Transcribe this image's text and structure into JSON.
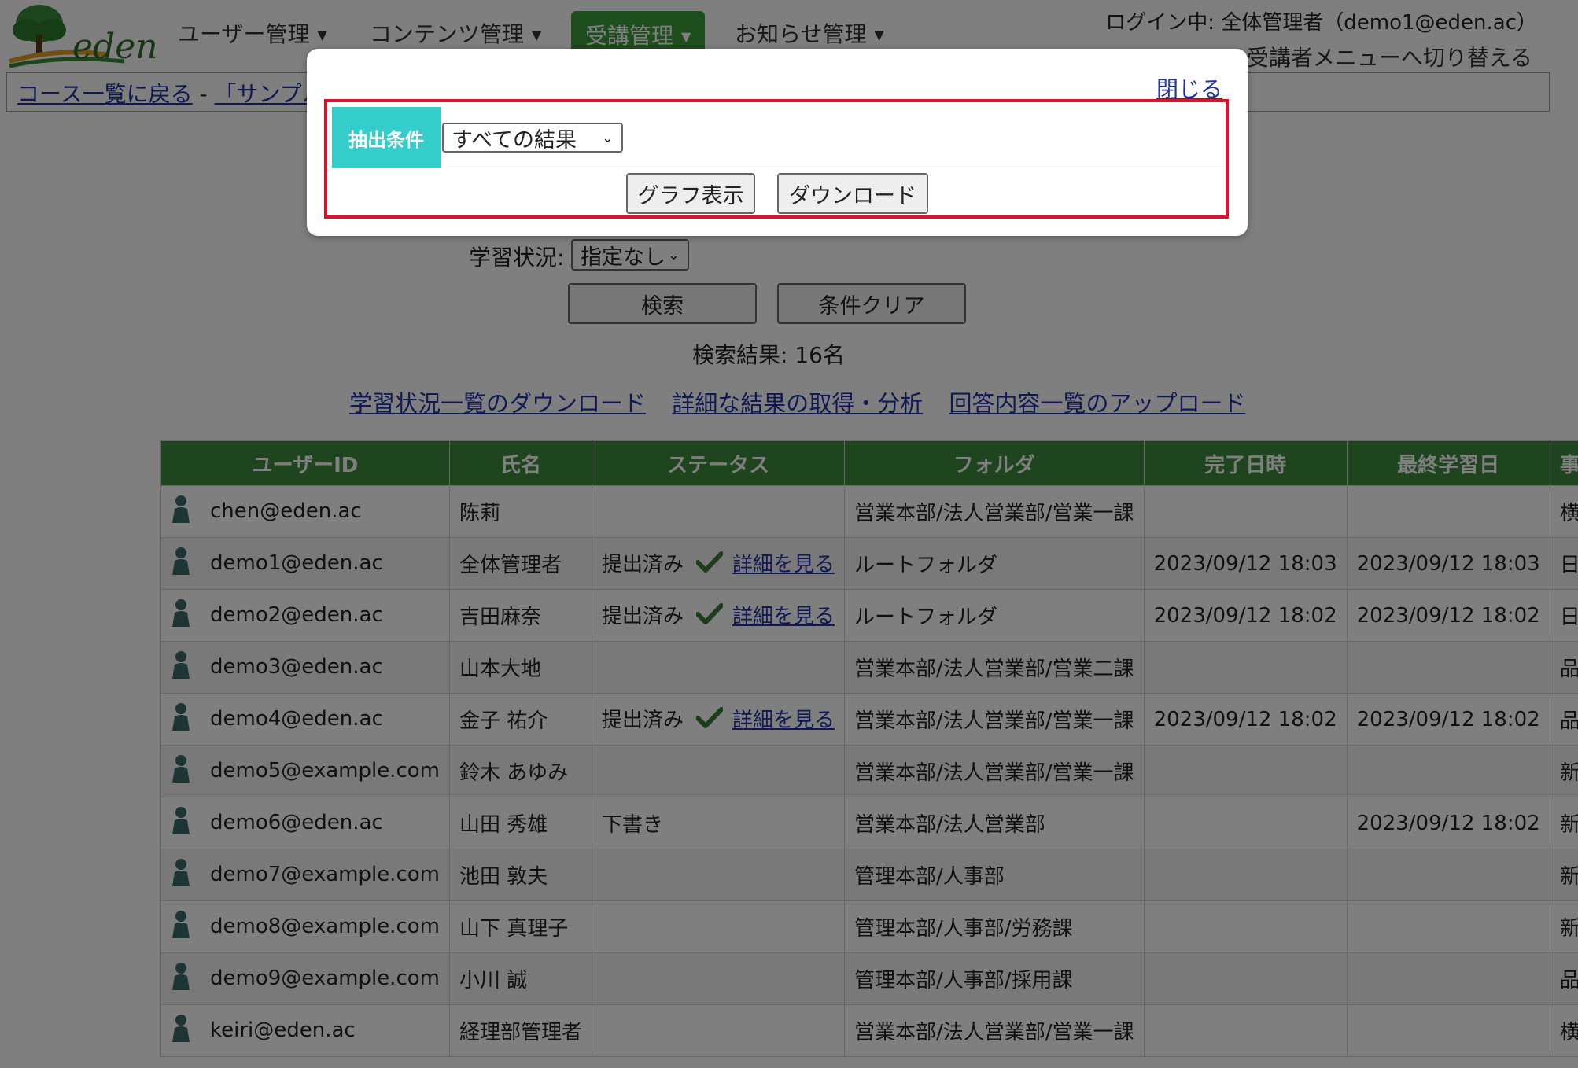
{
  "brand": {
    "logo_text": "eden"
  },
  "nav": {
    "items": [
      {
        "label": "ユーザー管理"
      },
      {
        "label": "コンテンツ管理"
      },
      {
        "label": "受講管理"
      },
      {
        "label": "お知らせ管理"
      }
    ]
  },
  "header": {
    "login_info": "ログイン中: 全体管理者（demo1@eden.ac）",
    "switch_menu": "受講者メニューへ切り替える"
  },
  "breadcrumb": {
    "back_link": "コース一覧に戻る",
    "separator": " - ",
    "course_link": "「サンプル"
  },
  "filters": {
    "study_status_label": "学習状況:",
    "study_status_value": "指定なし",
    "search_button": "検索",
    "clear_button": "条件クリア",
    "result_count": "検索結果: 16名"
  },
  "actions": {
    "download_status": "学習状況一覧のダウンロード",
    "detailed_results": "詳細な結果の取得・分析",
    "upload_answers": "回答内容一覧のアップロード"
  },
  "table": {
    "headers": [
      "ユーザーID",
      "氏名",
      "ステータス",
      "フォルダ",
      "完了日時",
      "最終学習日",
      "事業所"
    ],
    "detail_link": "詳細を見る",
    "rows": [
      {
        "id": "chen@eden.ac",
        "name": "陈莉",
        "status": "",
        "detail": false,
        "folder": "営業本部/法人営業部/営業一課",
        "completed": "",
        "last": "",
        "office": "横浜"
      },
      {
        "id": "demo1@eden.ac",
        "name": "全体管理者",
        "status": "提出済み",
        "detail": true,
        "folder": "ルートフォルダ",
        "completed": "2023/09/12 18:03",
        "last": "2023/09/12 18:03",
        "office": "日本橋"
      },
      {
        "id": "demo2@eden.ac",
        "name": "吉田麻奈",
        "status": "提出済み",
        "detail": true,
        "folder": "ルートフォルダ",
        "completed": "2023/09/12 18:02",
        "last": "2023/09/12 18:02",
        "office": "日本橋"
      },
      {
        "id": "demo3@eden.ac",
        "name": "山本大地",
        "status": "",
        "detail": false,
        "folder": "営業本部/法人営業部/営業二課",
        "completed": "",
        "last": "",
        "office": "品川"
      },
      {
        "id": "demo4@eden.ac",
        "name": "金子 祐介",
        "status": "提出済み",
        "detail": true,
        "folder": "営業本部/法人営業部/営業一課",
        "completed": "2023/09/12 18:02",
        "last": "2023/09/12 18:02",
        "office": "品川"
      },
      {
        "id": "demo5@example.com",
        "name": "鈴木 あゆみ",
        "status": "",
        "detail": false,
        "folder": "営業本部/法人営業部/営業一課",
        "completed": "",
        "last": "",
        "office": "新宿"
      },
      {
        "id": "demo6@eden.ac",
        "name": "山田 秀雄",
        "status": "下書き",
        "detail": false,
        "folder": "営業本部/法人営業部",
        "completed": "",
        "last": "2023/09/12 18:02",
        "office": "新宿"
      },
      {
        "id": "demo7@example.com",
        "name": "池田 敦夫",
        "status": "",
        "detail": false,
        "folder": "管理本部/人事部",
        "completed": "",
        "last": "",
        "office": "新宿"
      },
      {
        "id": "demo8@example.com",
        "name": "山下 真理子",
        "status": "",
        "detail": false,
        "folder": "管理本部/人事部/労務課",
        "completed": "",
        "last": "",
        "office": "新宿"
      },
      {
        "id": "demo9@example.com",
        "name": "小川 誠",
        "status": "",
        "detail": false,
        "folder": "管理本部/人事部/採用課",
        "completed": "",
        "last": "",
        "office": "品川"
      },
      {
        "id": "keiri@eden.ac",
        "name": "経理部管理者",
        "status": "",
        "detail": false,
        "folder": "営業本部/法人営業部/営業一課",
        "completed": "",
        "last": "",
        "office": "横浜"
      }
    ]
  },
  "modal": {
    "close_link": "閉じる",
    "condition_label": "抽出条件",
    "condition_value": "すべての結果",
    "graph_button": "グラフ表示",
    "download_button": "ダウンロード"
  },
  "colors": {
    "nav_active": "#3c9a3c",
    "table_header": "#3d8a3d",
    "condition_label_bg": "#35cccc",
    "highlight_border": "#e0102a",
    "link": "#2233aa"
  }
}
